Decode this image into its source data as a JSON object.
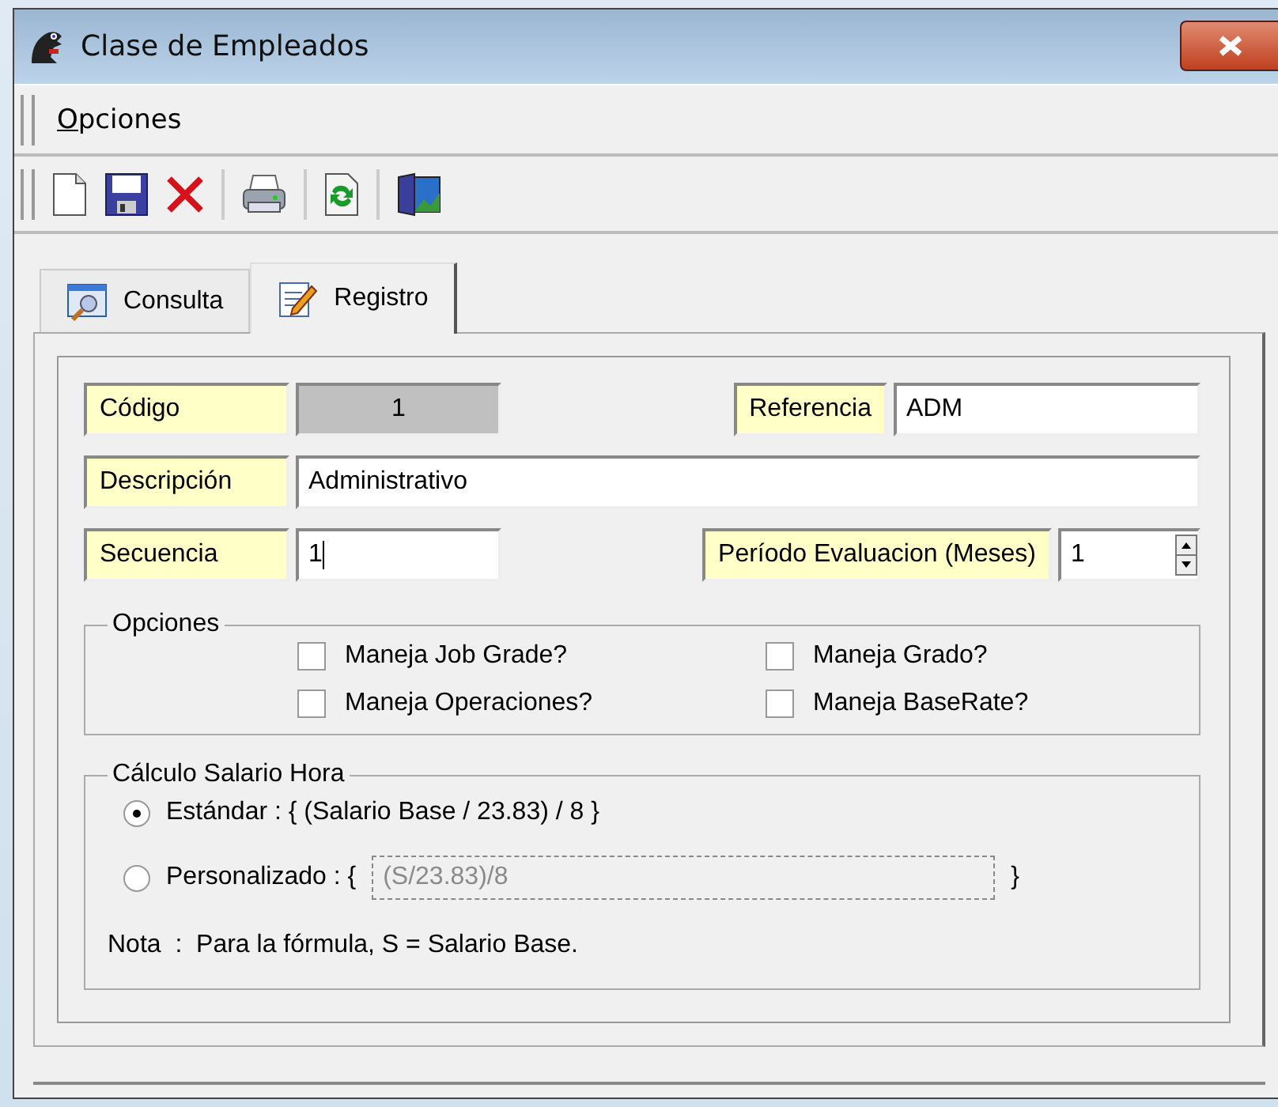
{
  "window": {
    "title": "Clase de Empleados"
  },
  "menu": [
    {
      "label": "Opciones"
    }
  ],
  "toolbar": [
    [
      {
        "kind": "new"
      },
      {
        "kind": "save"
      },
      {
        "kind": "delete"
      }
    ],
    [
      {
        "kind": "print"
      }
    ],
    [
      {
        "kind": "refresh"
      }
    ],
    [
      {
        "kind": "exit"
      }
    ]
  ],
  "tabs": [
    {
      "label": "Consulta",
      "kind": "query",
      "selected": false
    },
    {
      "label": "Registro",
      "kind": "edit",
      "selected": true
    }
  ],
  "form": {
    "codigo": {
      "label": "Código",
      "value": "1",
      "disabled": true
    },
    "referencia": {
      "label": "Referencia",
      "value": "ADM"
    },
    "descripcion": {
      "label": "Descripción",
      "value": "Administrativo"
    },
    "secuencia": {
      "label": "Secuencia",
      "value": "1",
      "focused": true
    },
    "periodo": {
      "label": "Período Evaluacion (Meses)",
      "value": "1"
    }
  },
  "opciones": {
    "title": "Opciones",
    "checkboxes": [
      {
        "label": "Maneja Job Grade?",
        "checked": false
      },
      {
        "label": "Maneja Grado?",
        "checked": false
      },
      {
        "label": "Maneja Operaciones?",
        "checked": false
      },
      {
        "label": "Maneja BaseRate?",
        "checked": false
      }
    ]
  },
  "calculo": {
    "title": "Cálculo Salario Hora",
    "options": [
      {
        "label": "Estándar : { (Salario Base / 23.83) / 8 }",
        "selected": true
      },
      {
        "label": "Personalizado : {",
        "selected": false,
        "formula": {
          "value": "(S/23.83)/8",
          "disabled": true
        },
        "closing": "}"
      }
    ],
    "note": "Nota  :  Para la fórmula, S = Salario Base."
  }
}
